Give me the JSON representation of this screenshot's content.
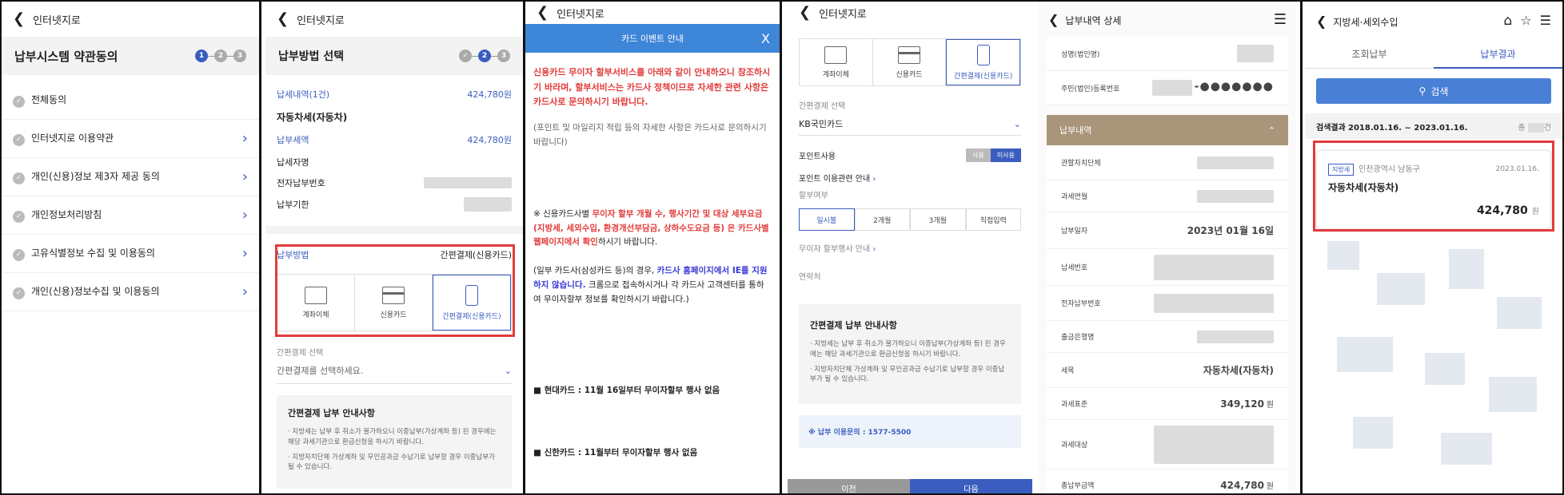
{
  "p1": {
    "back": "인터넷지로",
    "title": "납부시스템 약관동의",
    "steps": [
      "1",
      "2",
      "3"
    ],
    "items": [
      "전체동의",
      "인터넷지로 이용약관",
      "개인(신용)정보 제3자 제공 동의",
      "개인정보처리방침",
      "고유식별정보 수집 및 이용동의",
      "개인(신용)정보수집 및 이용동의"
    ]
  },
  "p2": {
    "back": "인터넷지로",
    "title": "납부방법 선택",
    "steps": [
      "2",
      "3"
    ],
    "summary_label": "납세내역(1건)",
    "summary_value": "424,780원",
    "tax_name": "자동차세(자동차)",
    "amount_label": "납부세액",
    "amount_value": "424,780원",
    "payer_label": "납세자명",
    "epay_label": "전자납부번호",
    "due_label": "납부기한",
    "method_label": "납부방법",
    "method_value": "간편결제(신용카드)",
    "methods": [
      "계좌이체",
      "신용카드",
      "간편결제(신용카드)"
    ],
    "easy_label": "간편결제 선택",
    "easy_placeholder": "간편결제를 선택하세요.",
    "notice_title": "간편결제 납부 안내사항",
    "notices": [
      "지방세는 납부 후 취소가 불가하오니 이중납부(가상계좌 등) 된 경우에는 해당 과세기관으로 환급신청을 하시기 바랍니다.",
      "지방자치단체 가상계좌 및 무인공과금 수납기로 납부할 경우 이중납부가 될 수 있습니다."
    ]
  },
  "p3": {
    "back": "인터넷지로",
    "modal_title": "카드 이벤트 안내",
    "close": "X",
    "para1": "신용카드 무이자 할부서비스를 아래와 같이 안내하오니 참조하시기 바라며, 할부서비스는 카드사 정책이므로 자세한 관련 사항은 카드사로 문의하시기 바랍니다.",
    "para2": "(포인트 및 마일리지 적립 등의 자세한 사항은 카드사로 문의하시기 바랍니다)",
    "p3a": "※ 신용카드사별 ",
    "p3b": "무이자 할부 개월 수, 행사기간 및 대상 세부요금(지방세, 세외수입, 환경개선부담금, 상하수도요금 등) 은 카드사별 웹페이지에서 확인",
    "p3c": "하시기 바랍니다.",
    "p4a": "(일부 카드사(삼성카드 등)의 경우, ",
    "p4b": "카드사 홈페이지에서 IE를 지원하지 않습니다.",
    "p4c": " 크롬으로 접속하시거나 각 카드사 고객센터를 통하여 무이자할부 정보를 확인하시기 바랍니다.)",
    "hyundai": "■ 현대카드 : 11월 16일부터 무이자할부 행사 없음",
    "shinhan": "■ 신한카드 : 11월부터 무이자할부 행사 없음"
  },
  "p4": {
    "back": "인터넷지로",
    "methods": [
      "계좌이체",
      "신용카드",
      "간편결제(신용카드)"
    ],
    "easy_label": "간편결제 선택",
    "easy_value": "KB국민카드",
    "point_label": "포인트사용",
    "point_opts": [
      "사용",
      "미사용"
    ],
    "point_guide": "포인트 이용관련 안내",
    "install_label": "할부여부",
    "install_opts": [
      "일시불",
      "2개월",
      "3개월",
      "직접입력"
    ],
    "noint": "무이자 할부행사 안내",
    "contact_label": "연락처",
    "notice_title": "간편결제 납부 안내사항",
    "notices": [
      "지방세는 납부 후 취소가 불가하오니 이중납부(가상계좌 등) 된 경우에는 해당 과세기관으로 환급신청을 하시기 바랍니다.",
      "지방자치단체 가상계좌 및 무인공과금 수납기로 납부할 경우 이중납부가 될 수 있습니다."
    ],
    "inquiry": "※ 납부 이용문의 : 1577-5500",
    "prev": "이전",
    "next": "다음"
  },
  "p5": {
    "back": "납부내역 상세",
    "r1": "성명(법인명)",
    "r2": "주민(법인)등록번호",
    "masked": "-●●●●●●●",
    "section": "납부내역",
    "rows": [
      "관할자치단체",
      "과세연월",
      "납부일자",
      "납세번호",
      "전자납부번호",
      "출금은행명",
      "세목",
      "과세표준",
      "과세대상",
      "총납부금액"
    ],
    "pay_date": "2023년 01월 16일",
    "tax_item": "자동차세(자동차)",
    "base": "349,120",
    "total": "424,780",
    "won": "원"
  },
  "p6": {
    "back": "지방세·세외수입",
    "tabs": [
      "조회납부",
      "납부결과"
    ],
    "search": "검색",
    "result_label": "검색결과",
    "range": "2018.01.16. ~ 2023.01.16.",
    "total_prefix": "총",
    "total_suffix": "건",
    "tag": "지방세",
    "region": "인천광역시 남동구",
    "date": "2023.01.16.",
    "tax": "자동차세(자동차)",
    "amount": "424,780",
    "won": "원"
  }
}
